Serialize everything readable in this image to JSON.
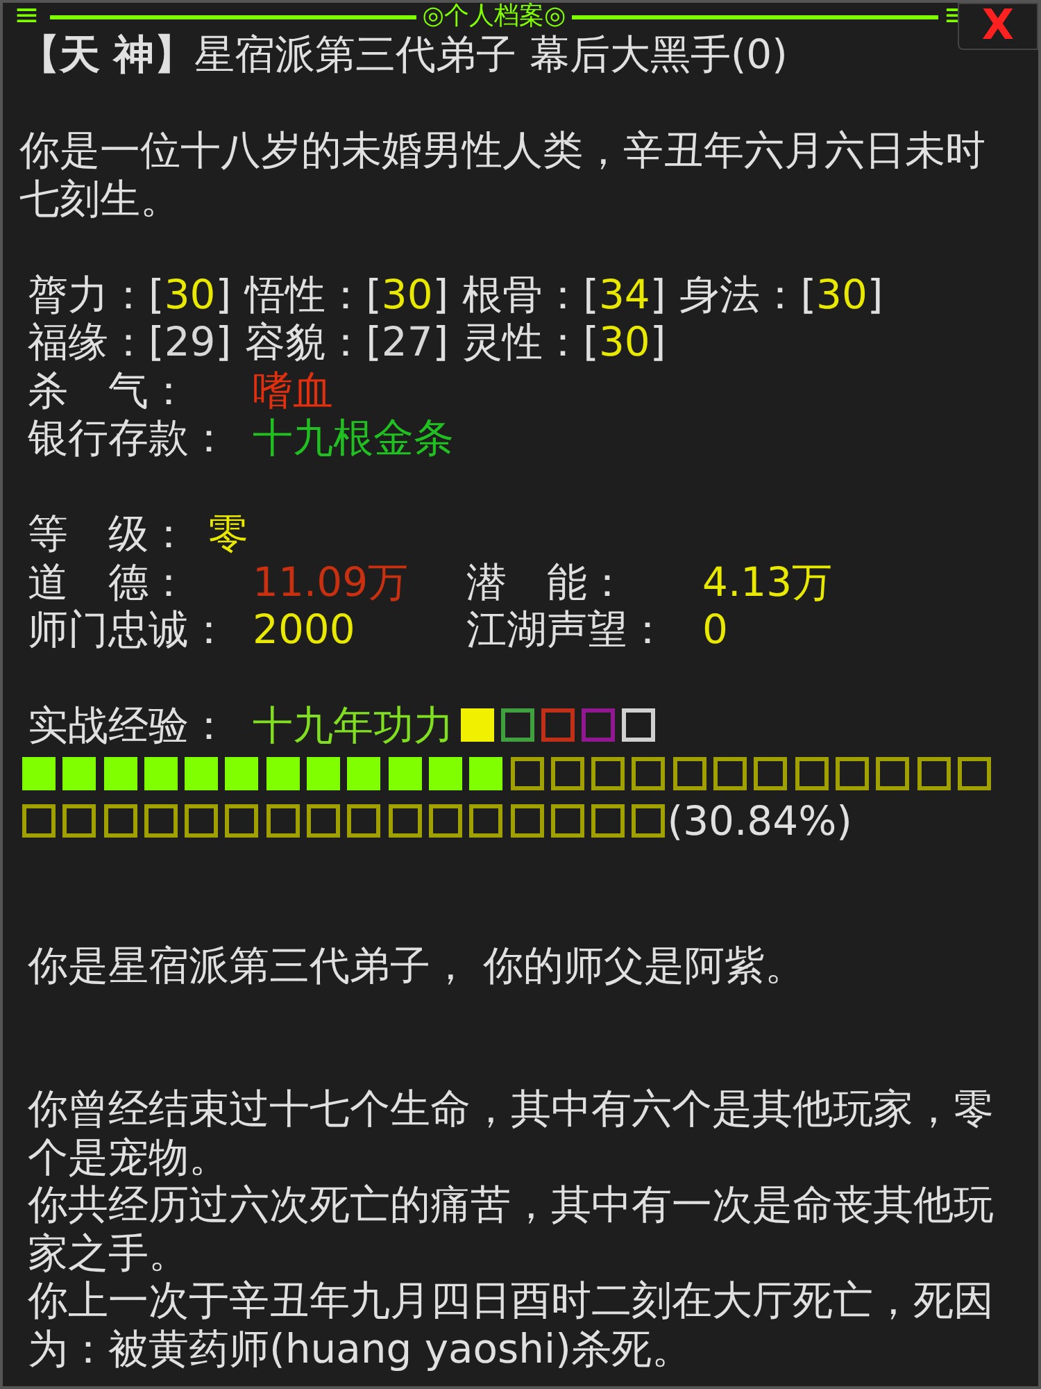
{
  "header": {
    "menu": "≡",
    "title": "◎个人档案◎",
    "right_mark": "≡",
    "close": "X"
  },
  "identity": {
    "rank": "【天 神】",
    "text": "星宿派第三代弟子 幕后大黑手(0)"
  },
  "intro": "你是一位十八岁的未婚男性人类，辛丑年六月六日未时七刻生。",
  "brackets": [
    "[",
    "]"
  ],
  "attribute_rows": [
    [
      {
        "label": "膂力：",
        "value": "30",
        "color": "#e8e800"
      },
      {
        "label": "悟性：",
        "value": "30",
        "color": "#e8e800"
      },
      {
        "label": "根骨：",
        "value": "34",
        "color": "#e8e800"
      },
      {
        "label": "身法：",
        "value": "30",
        "color": "#e8e800"
      }
    ],
    [
      {
        "label": "福缘：",
        "value": "29",
        "color": "#d8d8d8"
      },
      {
        "label": "容貌：",
        "value": "27",
        "color": "#d8d8d8"
      },
      {
        "label": "灵性：",
        "value": "30",
        "color": "#e8e800"
      }
    ]
  ],
  "status": [
    {
      "label": "杀　气：",
      "value": "嗜血",
      "color": "#e03010"
    },
    {
      "label": "银行存款：",
      "value": "十九根金条",
      "color": "#20c020"
    }
  ],
  "level": {
    "label": "等　级：",
    "value": "零",
    "color": "#e8e800"
  },
  "stats": [
    [
      {
        "label": "道　德：",
        "value": "11.09万",
        "color": "#c83010"
      },
      {
        "label": "潜　能：",
        "value": "4.13万",
        "color": "#e8e800"
      }
    ],
    [
      {
        "label": "师门忠诚：",
        "value": "2000",
        "color": "#e8e800"
      },
      {
        "label": "江湖声望：",
        "value": "0",
        "color": "#e8e800"
      }
    ]
  ],
  "experience": {
    "label": "实战经验：",
    "value": "十九年功力",
    "tiers": [
      {
        "color": "#f0f000",
        "filled": true
      },
      {
        "color": "#40a040",
        "filled": false
      },
      {
        "color": "#c03018",
        "filled": false
      },
      {
        "color": "#901890",
        "filled": false
      },
      {
        "color": "#d0d0d0",
        "filled": false
      }
    ],
    "level": 0.3084,
    "percent": "(30.84%)"
  },
  "paragraphs": [
    [
      "你是星宿派第三代弟子， 你的师父是阿紫。"
    ],
    [
      "你曾经结束过十七个生命，其中有六个是其他玩家，零个是宠物。",
      "你共经历过六次死亡的痛苦，其中有一次是命丧其他玩家之手。",
      "你上一次于辛丑年九月四日酉时二刻在大厅死亡，死因为：被黄药师(huang yaoshi)杀死。"
    ]
  ]
}
